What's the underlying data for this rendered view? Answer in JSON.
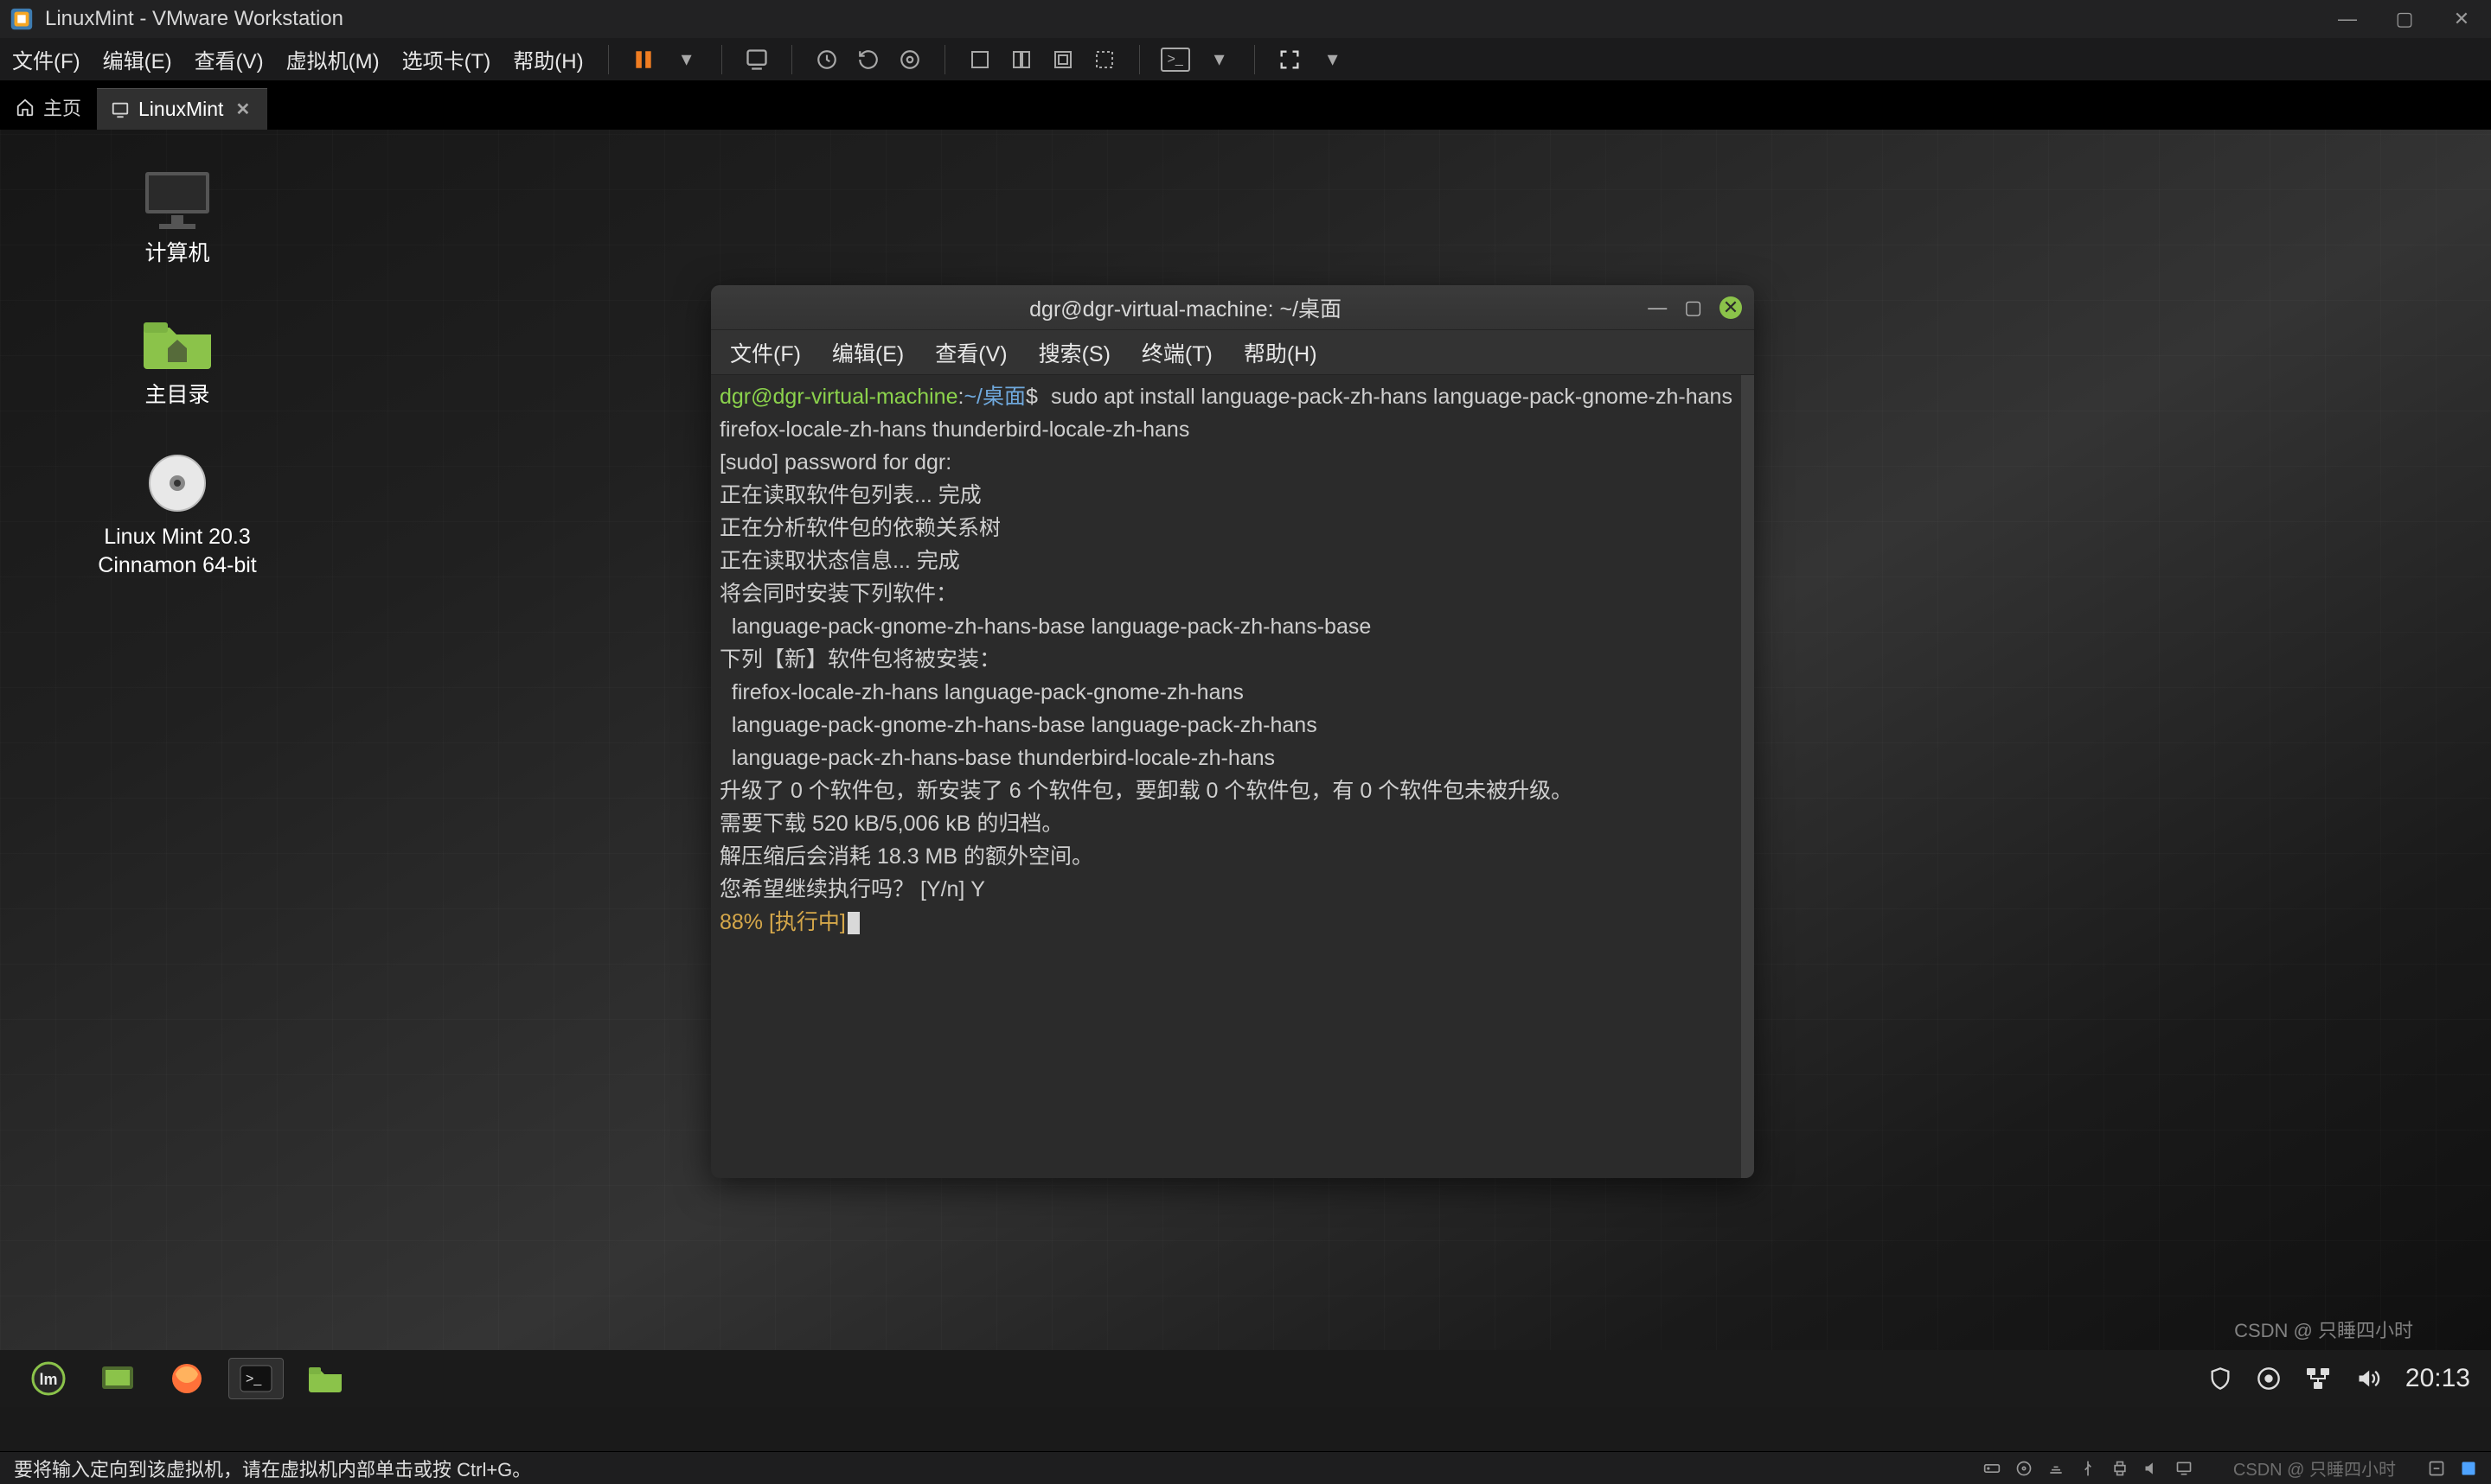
{
  "vmware": {
    "title": "LinuxMint - VMware Workstation",
    "menus": [
      "文件(F)",
      "编辑(E)",
      "查看(V)",
      "虚拟机(M)",
      "选项卡(T)",
      "帮助(H)"
    ],
    "tab_home": "主页",
    "tab_vm": "LinuxMint",
    "status_msg": "要将输入定向到该虚拟机，请在虚拟机内部单击或按 Ctrl+G。",
    "watermark": "CSDN @ 只睡四小时"
  },
  "desktop": {
    "computer": "计算机",
    "home": "主目录",
    "iso_l1": "Linux Mint 20.3",
    "iso_l2": "Cinnamon 64-bit"
  },
  "terminal": {
    "title": "dgr@dgr-virtual-machine: ~/桌面",
    "menus": [
      "文件(F)",
      "编辑(E)",
      "查看(V)",
      "搜索(S)",
      "终端(T)",
      "帮助(H)"
    ],
    "prompt_user": "dgr@dgr-virtual-machine",
    "prompt_sep": ":",
    "prompt_path": "~/桌面",
    "prompt_dollar": "$",
    "cmd": "sudo apt install language-pack-zh-hans language-pack-gnome-zh-hans firefox-locale-zh-hans thunderbird-locale-zh-hans",
    "line_sudo": "[sudo] password for dgr:",
    "line_read1": "正在读取软件包列表... 完成",
    "line_read2": "正在分析软件包的依赖关系树",
    "line_read3": "正在读取状态信息... 完成",
    "line_extra_hdr": "将会同时安装下列软件：",
    "line_extra_pkgs": "  language-pack-gnome-zh-hans-base language-pack-zh-hans-base",
    "line_new_hdr": "下列【新】软件包将被安装：",
    "line_new_p1": "  firefox-locale-zh-hans language-pack-gnome-zh-hans",
    "line_new_p2": "  language-pack-gnome-zh-hans-base language-pack-zh-hans",
    "line_new_p3": "  language-pack-zh-hans-base thunderbird-locale-zh-hans",
    "line_upg": "升级了 0 个软件包，新安装了 6 个软件包，要卸载 0 个软件包，有 0 个软件包未被升级。",
    "line_dl": "需要下载 520 kB/5,006 kB 的归档。",
    "line_disk": "解压缩后会消耗 18.3 MB 的额外空间。",
    "line_prompt": "您希望继续执行吗？ [Y/n] Y",
    "line_progress": "88% [执行中]"
  },
  "panel": {
    "clock": "20:13"
  }
}
